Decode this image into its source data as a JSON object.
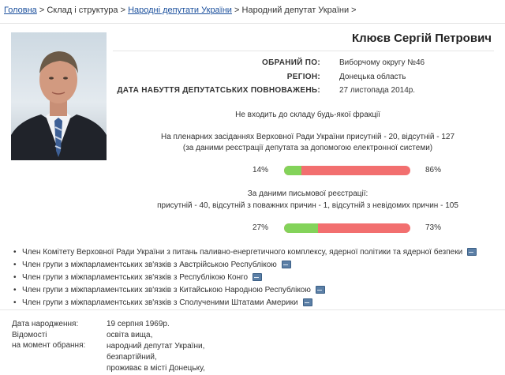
{
  "breadcrumbs": {
    "home": "Головна",
    "structure": "Склад і структура",
    "deputies": "Народні депутати України",
    "current": "Народний депутат України"
  },
  "deputy": {
    "name": "Клюєв Сергій Петрович",
    "info": [
      {
        "label": "ОБРАНИЙ ПО:",
        "value": "Виборчому округу №46"
      },
      {
        "label": "РЕГІОН:",
        "value": "Донецька область"
      },
      {
        "label": "ДАТА НАБУТТЯ ДЕПУТАТСЬКИХ ПОВНОВАЖЕНЬ:",
        "value": "27 листопада 2014р."
      }
    ],
    "faction": "Не входить до складу будь-якої фракції"
  },
  "attendance": {
    "plenary_line1": "На пленарних засіданнях Верховної Ради України присутній - 20, відсутній - 127",
    "plenary_line2": "(за даними реєстрації депутата за допомогою електронної системи)",
    "electronic": {
      "present_label": "14%",
      "absent_label": "86%",
      "present_fraction": 0.14
    },
    "written_title": "За даними письмової реєстрації:",
    "written_line": "присутній - 40, відсутній з поважних причин - 1, відсутній з невідомих причин - 105",
    "written": {
      "present_label": "27%",
      "absent_label": "73%",
      "present_fraction": 0.27
    },
    "colors": {
      "present": "#83d35a",
      "absent": "#f26f6f"
    }
  },
  "memberships": [
    "Член Комітету Верховної Ради України з питань паливно-енергетичного комплексу, ядерної політики та ядерної безпеки",
    "Член групи з міжпарламентських зв'язків з Австрійською Республікою",
    "Член групи з міжпарламентських зв'язків з Республікою Конго",
    "Член групи з міжпарламентських зв'язків з Китайською Народною Республікою",
    "Член групи з міжпарламентських зв'язків з Сполученими Штатами Америки"
  ],
  "bio": {
    "birth_label": "Дата народження:",
    "birth_value": "19 серпня 1969р.",
    "info_label_1": "Відомості",
    "info_label_2": "на момент обрання:",
    "info_values": [
      "освіта вища,",
      "народний депутат України,",
      "безпартійний,",
      "проживає в місті Донецьку,"
    ]
  }
}
